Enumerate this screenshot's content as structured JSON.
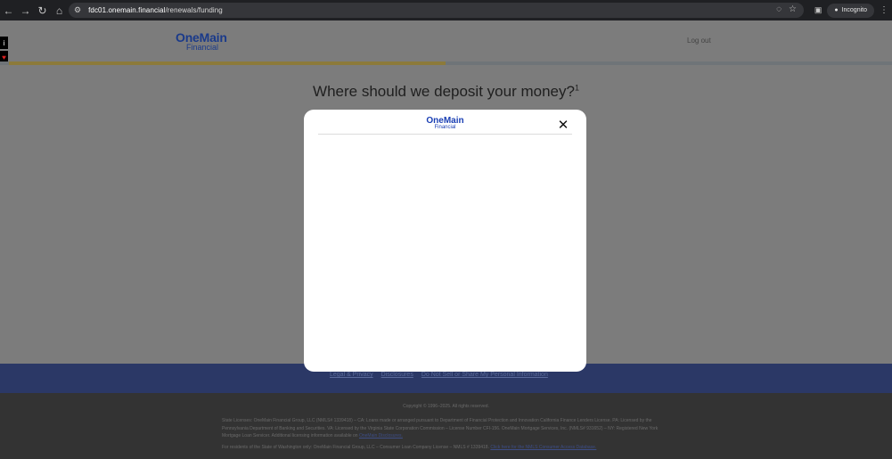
{
  "browser": {
    "url_host": "fdc01.onemain.financial",
    "url_path": "/renewals/funding",
    "incognito_label": "Incognito",
    "icons": [
      "back-icon",
      "forward-icon",
      "reload-icon",
      "home-icon",
      "site-info-icon",
      "eye-off-icon",
      "star-icon",
      "tab-search-icon",
      "incognito-icon",
      "menu-icon"
    ]
  },
  "page": {
    "logo_main": "OneMain",
    "logo_sub": "Financial",
    "logout_label": "Log out",
    "progress": 0.49,
    "question": "Where should we deposit your money?",
    "question_sup": "1"
  },
  "footer": {
    "links": [
      "Legal & Privacy",
      "Disclosures",
      "Do Not Sell or Share My Personal Information"
    ],
    "copyright": "Copyright © 1996–2025. All rights reserved.",
    "legal_text": "State Licenses: OneMain Financial Group, LLC (NMLS# 1339418) – CA: Loans made or arranged pursuant to Department of Financial Protection and Innovation California Finance Lenders License. PA: Licensed by the Pennsylvania Department of Banking and Securities. VA: Licensed by the Virginia State Corporation Commission – License Number CFI-156. OneMain Mortgage Services, Inc. (NMLS# 931652) – NY: Registered New York Mortgage Loan Servicer. Additional licensing information available on",
    "legal_link": "OneMain Disclosures.",
    "wa_text": "For residents of the State of Washington only: OneMain Financial Group, LLC – Consumer Loan Company License – NMLS # 1339418.",
    "wa_link": "Click here for the NMLS Consumer Access Database."
  },
  "modal": {
    "logo_main": "OneMain",
    "logo_sub": "Financial",
    "close_glyph": "✕"
  },
  "colors": {
    "brand_blue": "#1a3fb4",
    "footer_nav": "#2b3866"
  }
}
